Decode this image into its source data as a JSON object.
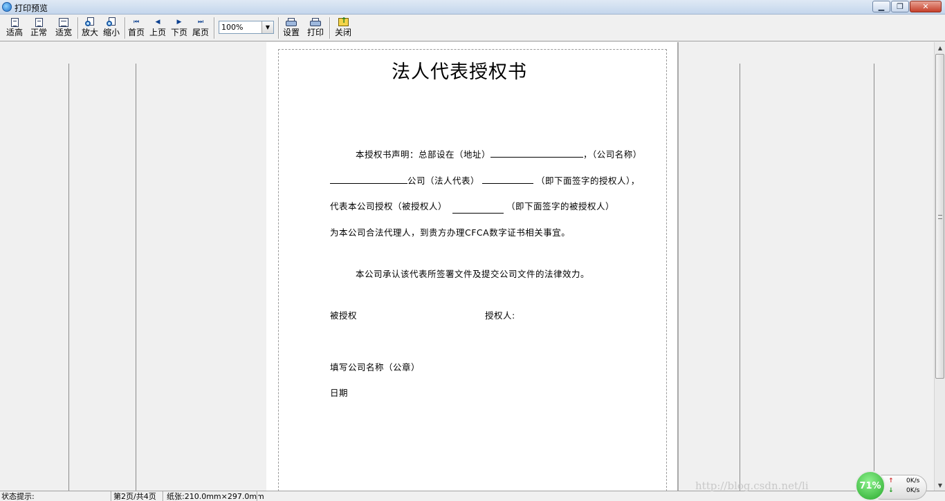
{
  "window": {
    "title": "打印预览",
    "minimize_glyph": "▁",
    "maximize_glyph": "❐",
    "close_glyph": "✕"
  },
  "toolbar": {
    "fit_height": "适高",
    "normal": "正常",
    "fit_width": "适宽",
    "zoom_in": "放大",
    "zoom_out": "缩小",
    "first_page": "首页",
    "prev_page": "上页",
    "next_page": "下页",
    "last_page": "尾页",
    "zoom_value": "100%",
    "settings": "设置",
    "print": "打印",
    "close": "关闭",
    "icons": {
      "first": "⏮",
      "prev": "◀",
      "next": "▶",
      "last": "⏭",
      "dropdown": "▼"
    }
  },
  "document": {
    "title": "法人代表授权书",
    "line1_a": "本授权书声明：总部设在（地址）",
    "line1_b": "，（公司名称）",
    "line2_a": "公司（法人代表）",
    "line2_b": "（即下面签字的授权人），",
    "line3_a": "代表本公司授权（被授权人）",
    "line3_b": "（即下面签字的被授权人）",
    "line4": "为本公司合法代理人，到贵方办理CFCA数字证书相关事宜。",
    "line5": "本公司承认该代表所签署文件及提交公司文件的法律效力。",
    "grantee": "被授权",
    "grantor": "授权人:",
    "company_seal": "填写公司名称（公章）",
    "date": "日期"
  },
  "scrollbar": {
    "up": "▲",
    "down": "▼"
  },
  "status": {
    "hint": "状态提示:",
    "page": "第2页/共4页",
    "paper": "纸张:210.0mm×297.0mm"
  },
  "overlay": {
    "watermark": "http://blog.csdn.net/li",
    "cpu_percent": "71%",
    "upload_arrow": "↑",
    "download_arrow": "↓",
    "upload_rate": "0K/s",
    "download_rate": "0K/s"
  }
}
